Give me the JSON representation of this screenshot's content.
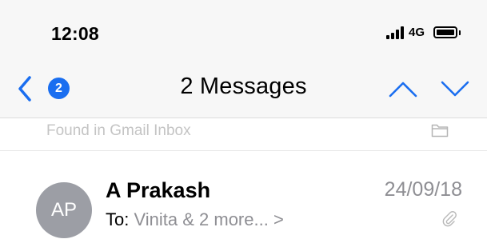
{
  "status_bar": {
    "time": "12:08",
    "network": "4G",
    "icons": [
      "signal-icon",
      "battery-icon"
    ]
  },
  "nav": {
    "back_badge": "2",
    "title": "2 Messages",
    "icons": [
      "chevron-left-icon",
      "chevron-up-icon",
      "chevron-down-icon"
    ]
  },
  "found_in": {
    "text": "Found in Gmail Inbox",
    "icon": "folder-icon"
  },
  "message": {
    "avatar_initials": "AP",
    "sender": "A Prakash",
    "to_label": "To:",
    "recipients": "Vinita & 2 more... >",
    "date": "24/09/18",
    "icon": "paperclip-icon"
  },
  "colors": {
    "accent": "#1a6ef0",
    "secondary_text": "#8e8e93",
    "avatar": "#9c9ea5"
  }
}
